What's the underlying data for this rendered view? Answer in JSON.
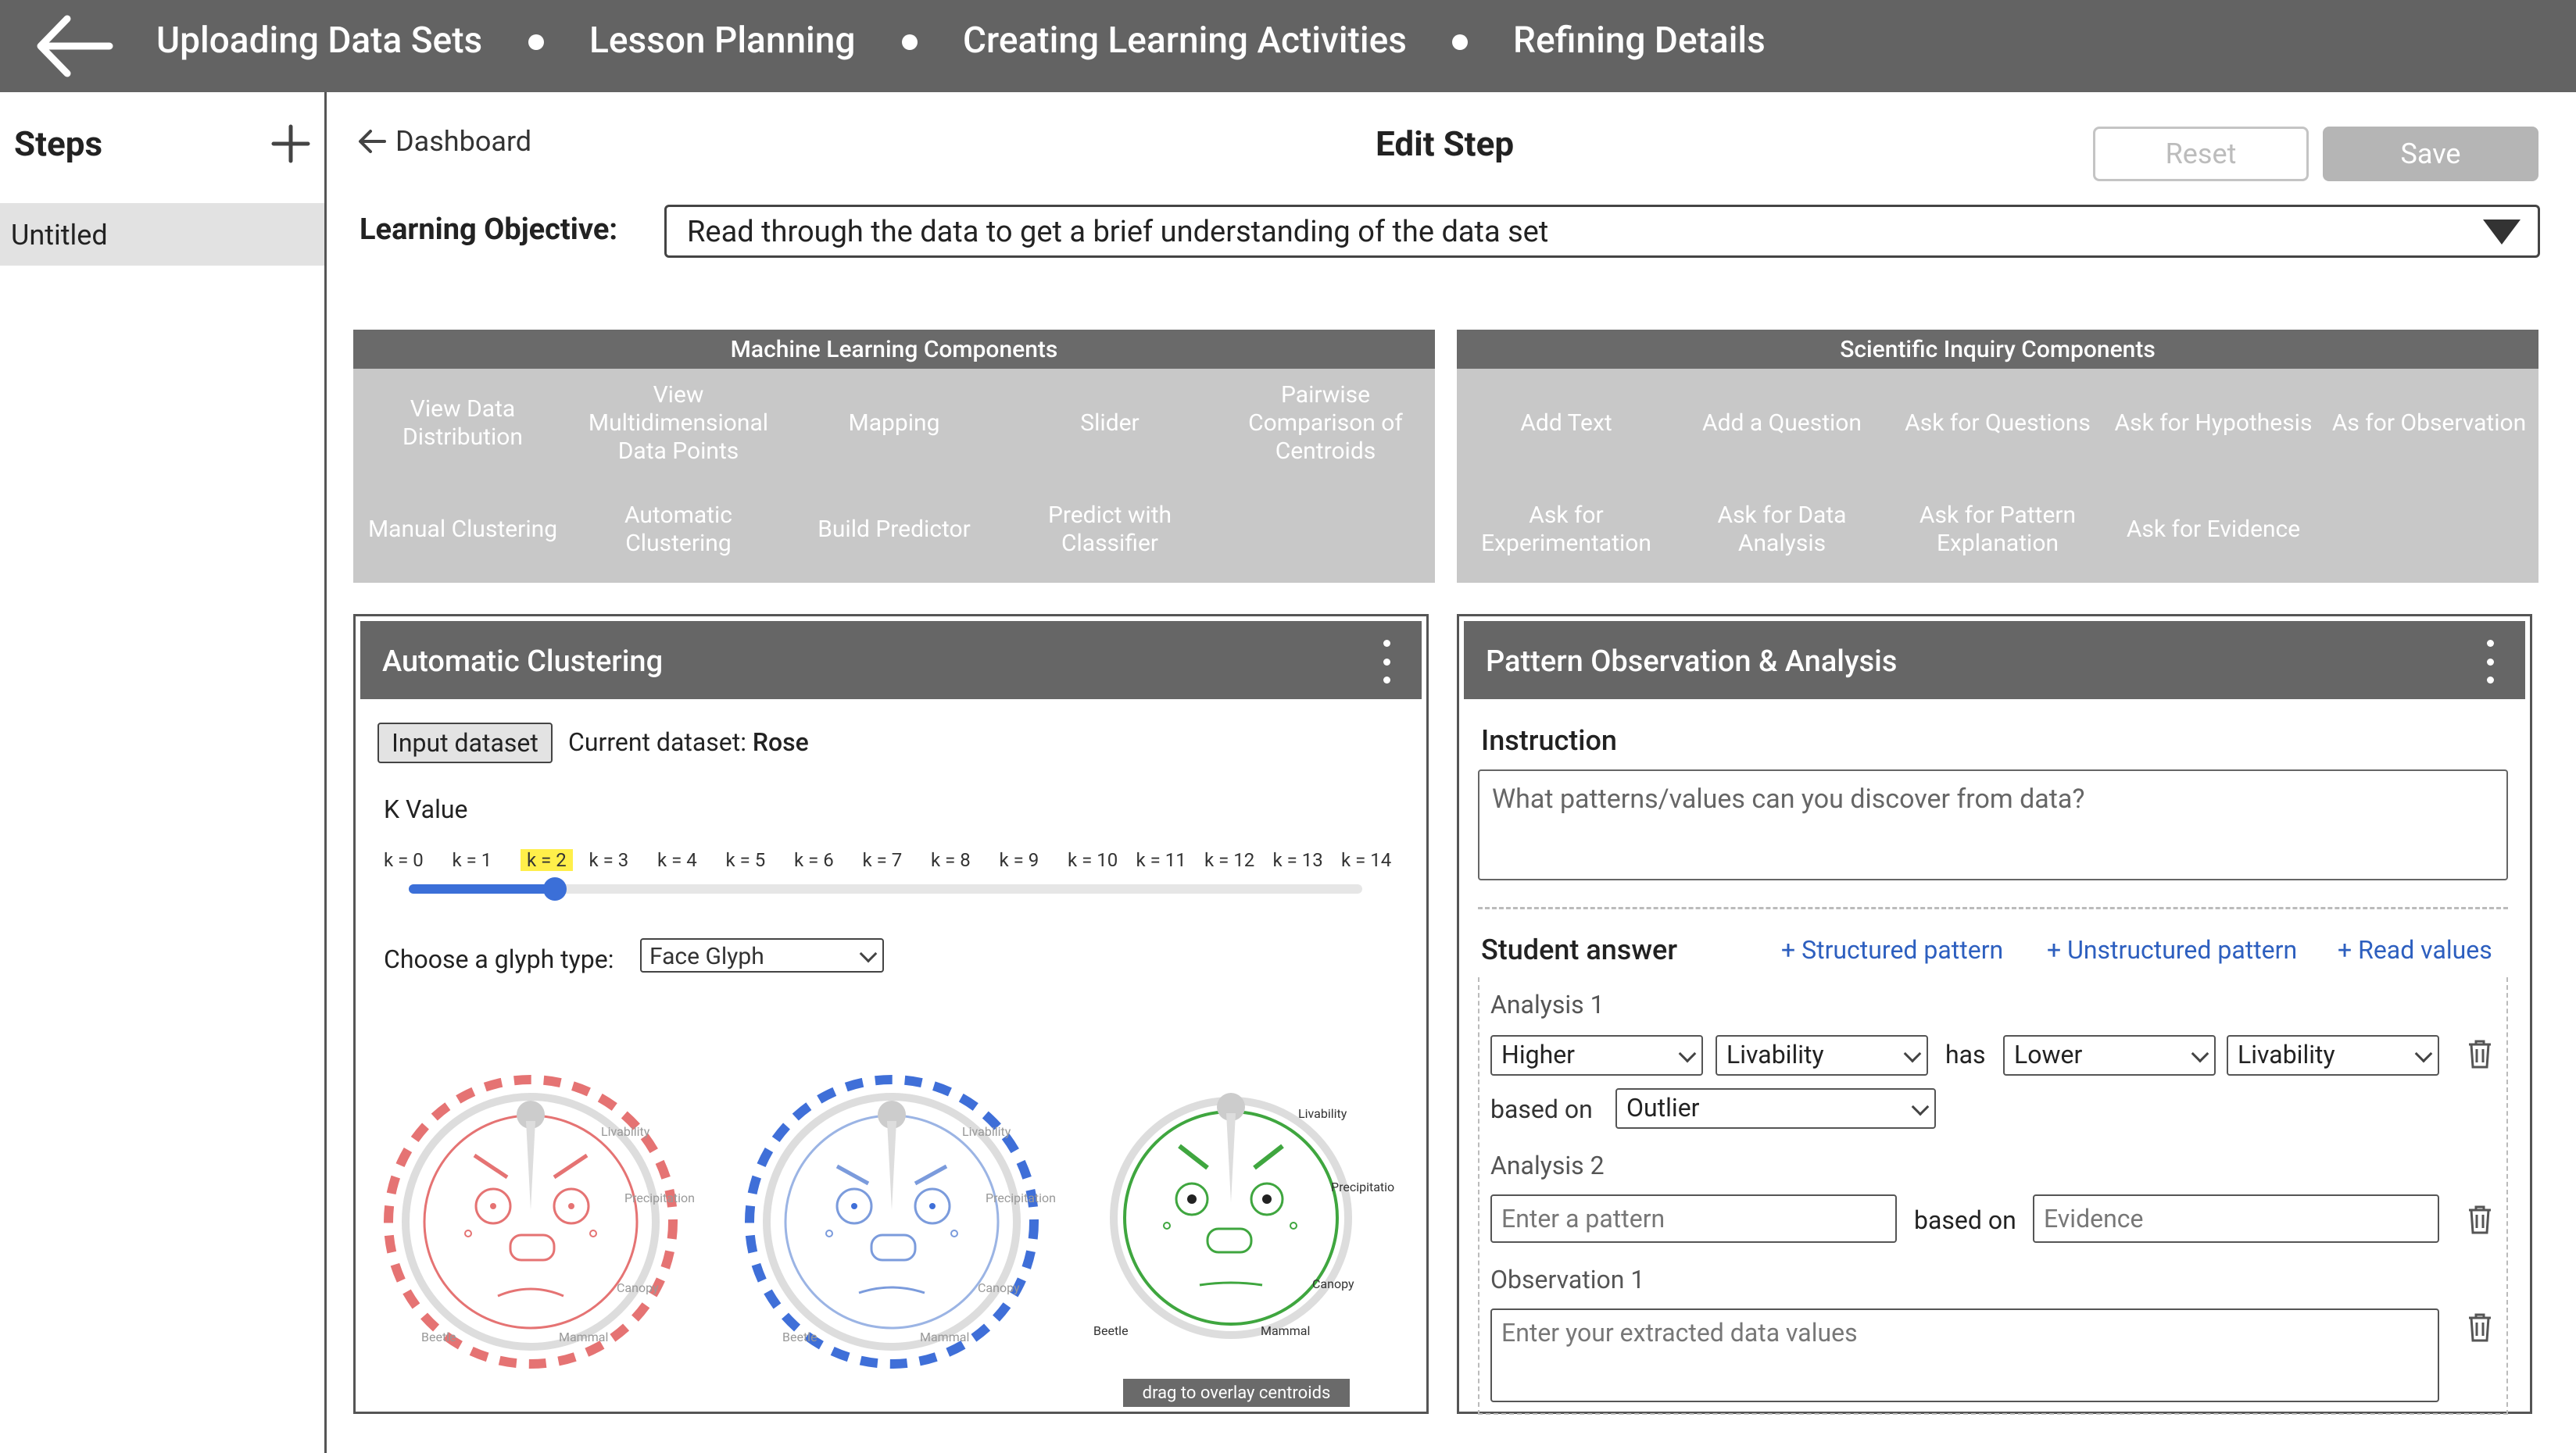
{
  "topbar": {
    "stages": [
      "Uploading Data Sets",
      "Lesson Planning",
      "Creating Learning Activities",
      "Refining Details"
    ]
  },
  "sidebar": {
    "title": "Steps",
    "items": [
      {
        "label": "Untitled"
      }
    ]
  },
  "header": {
    "back_label": "Dashboard",
    "title": "Edit Step",
    "reset_label": "Reset",
    "save_label": "Save"
  },
  "learning_objective": {
    "label": "Learning Objective:",
    "value": "Read through the data to get a brief understanding of the data set"
  },
  "ml_components": {
    "title": "Machine Learning Components",
    "items": [
      "View Data Distribution",
      "View Multidimensional Data Points",
      "Mapping",
      "Slider",
      "Pairwise Comparison of Centroids",
      "Manual Clustering",
      "Automatic Clustering",
      "Build Predictor",
      "Predict with Classifier"
    ]
  },
  "si_components": {
    "title": "Scientific Inquiry Components",
    "items": [
      "Add Text",
      "Add a Question",
      "Ask for Questions",
      "Ask for Hypothesis",
      "As for Observation",
      "Ask for Experimentation",
      "Ask for Data Analysis",
      "Ask for Pattern Explanation",
      "Ask for Evidence"
    ]
  },
  "clustering_panel": {
    "title": "Automatic Clustering",
    "input_button": "Input dataset",
    "current_dataset_label": "Current dataset:",
    "current_dataset": "Rose",
    "k_label": "K Value",
    "k_ticks": [
      "k = 0",
      "k = 1",
      "k = 2",
      "k = 3",
      "k = 4",
      "k = 5",
      "k = 6",
      "k = 7",
      "k = 8",
      "k = 9",
      "k = 10",
      "k = 11",
      "k = 12",
      "k = 13",
      "k = 14"
    ],
    "k_selected": "k = 2",
    "glyph_label": "Choose a glyph type:",
    "glyph_value": "Face Glyph",
    "glyph_labels": {
      "livability": "Livability",
      "precipitation": "Precipitation",
      "canopy": "Canopy",
      "mammal": "Mammal",
      "beetle": "Beetle"
    },
    "drag_hint": "drag to overlay centroids",
    "colors": {
      "cluster1": "#e57373",
      "cluster2": "#3f6fd8",
      "overlay": "#3fa63f"
    }
  },
  "pattern_panel": {
    "title": "Pattern Observation & Analysis",
    "instruction_label": "Instruction",
    "instruction_text": "What patterns/values can you discover from data?",
    "student_answer_label": "Student answer",
    "links": [
      "Structured pattern",
      "Unstructured pattern",
      "Read values"
    ],
    "analysis1": {
      "label": "Analysis 1",
      "sel1": "Higher",
      "sel2": "Livability",
      "has": "has",
      "sel3": "Lower",
      "sel4": "Livability",
      "based_on": "based on",
      "sel5": "Outlier"
    },
    "analysis2": {
      "label": "Analysis 2",
      "pattern_placeholder": "Enter a pattern",
      "based_on": "based on",
      "evidence_placeholder": "Evidence"
    },
    "observation1": {
      "label": "Observation 1",
      "placeholder": "Enter your extracted data values"
    }
  }
}
